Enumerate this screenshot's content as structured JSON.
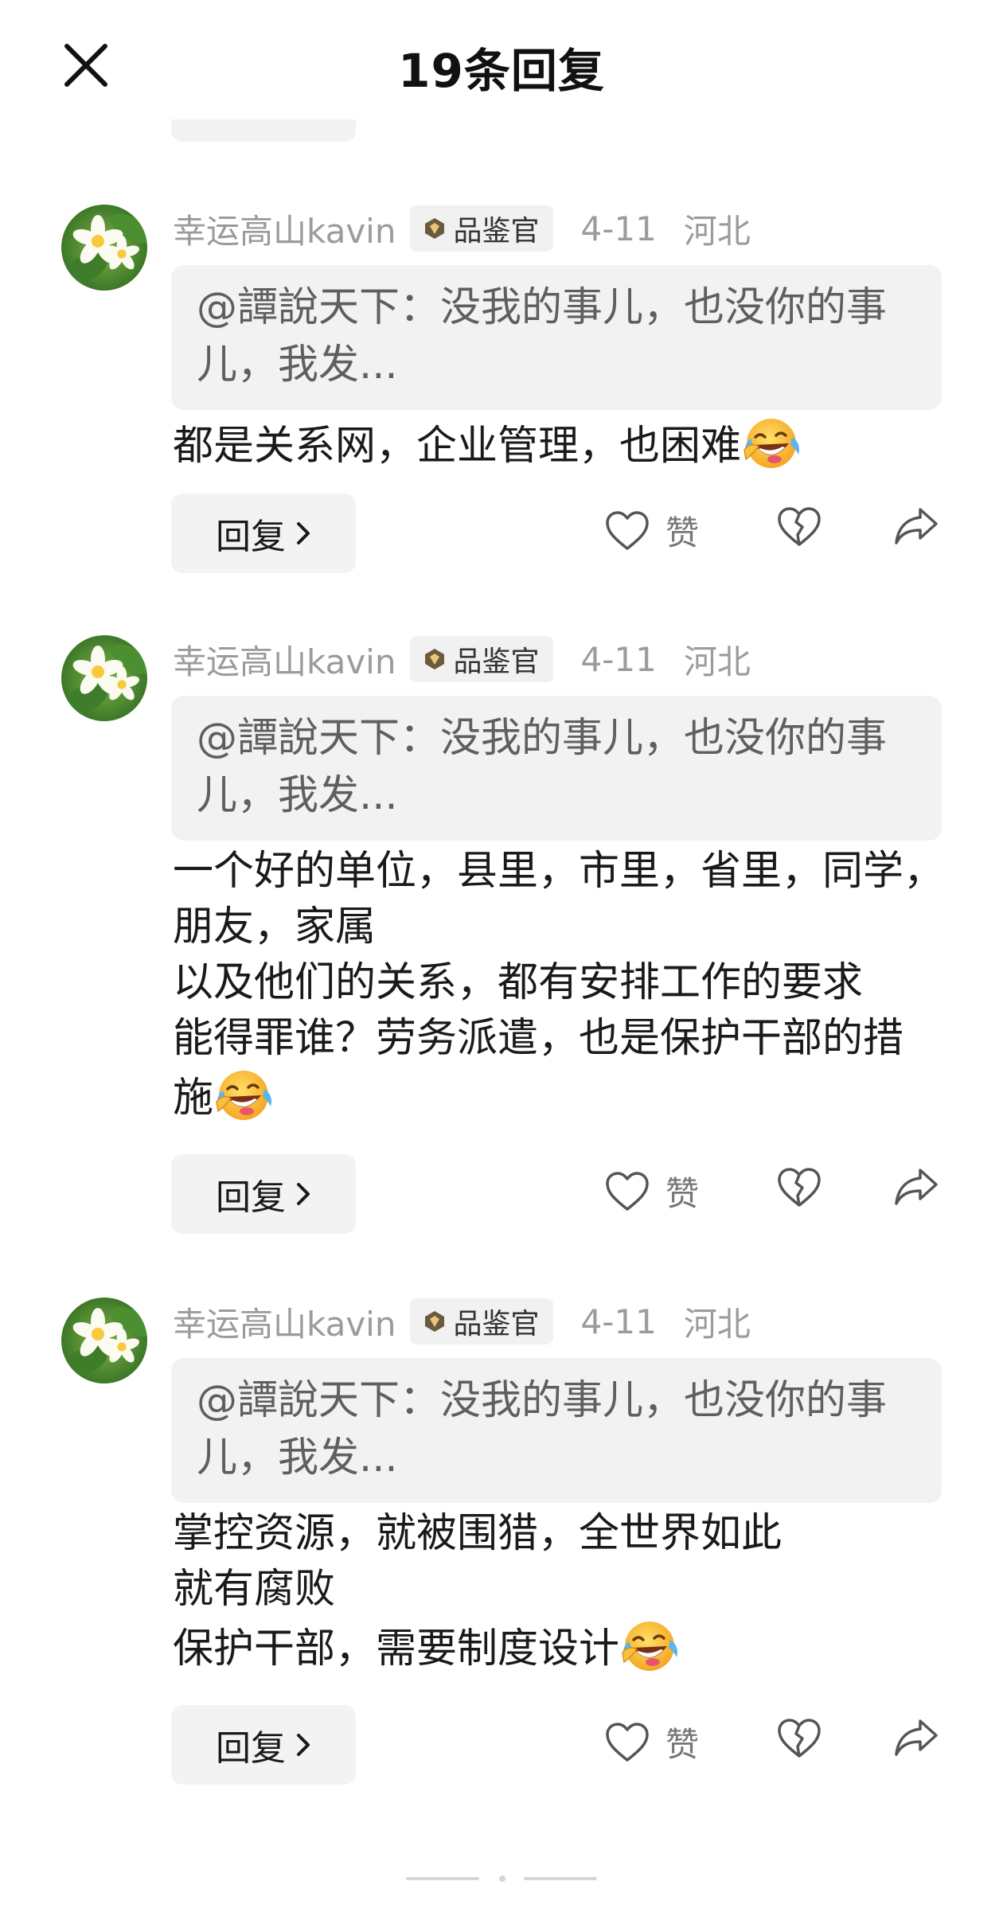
{
  "header": {
    "title": "19条回复",
    "close_icon": "close-icon"
  },
  "comments": [
    {
      "username": "幸运高山kavin",
      "badge": "品鉴官",
      "date": "4-11",
      "location": "河北",
      "quote": "@譚說天下：没我的事儿，也没你的事儿，我发...",
      "lines": [
        "都是关系网，企业管理，也困难"
      ],
      "emoji": "laughing-crying-emoji",
      "reply_label": "回复",
      "like_label": "赞"
    },
    {
      "username": "幸运高山kavin",
      "badge": "品鉴官",
      "date": "4-11",
      "location": "河北",
      "quote": "@譚說天下：没我的事儿，也没你的事儿，我发...",
      "lines": [
        "一个好的单位，县里，市里，省里，同学，",
        "朋友，家属",
        "以及他们的关系，都有安排工作的要求",
        "能得罪谁？劳务派遣，也是保护干部的措",
        "施"
      ],
      "emoji": "laughing-crying-emoji",
      "reply_label": "回复",
      "like_label": "赞"
    },
    {
      "username": "幸运高山kavin",
      "badge": "品鉴官",
      "date": "4-11",
      "location": "河北",
      "quote": "@譚說天下：没我的事儿，也没你的事儿，我发...",
      "lines": [
        "掌控资源，就被围猎，全世界如此",
        "就有腐败",
        "保护干部，需要制度设计"
      ],
      "emoji": "laughing-crying-emoji",
      "reply_label": "回复",
      "like_label": "赞"
    }
  ],
  "colors": {
    "meta_gray": "#9b9b9b",
    "quote_bg": "#f2f2f2",
    "button_bg": "#f3f3f3",
    "text": "#1a1a1a"
  }
}
